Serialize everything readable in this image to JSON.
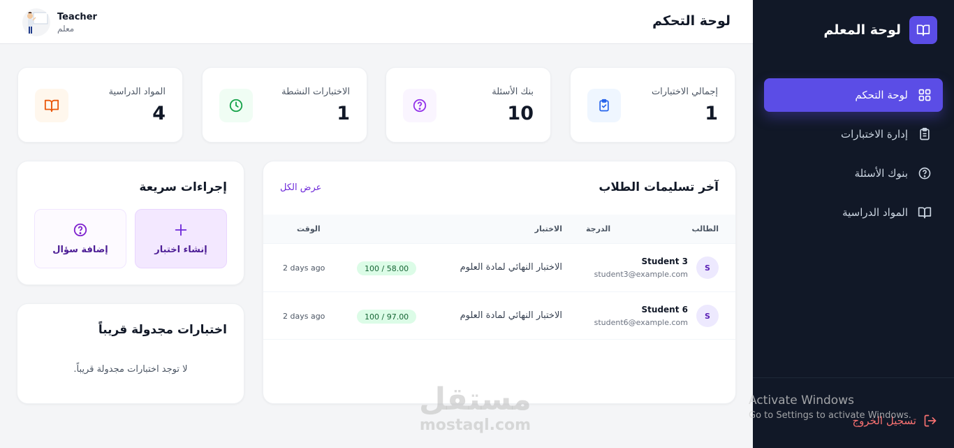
{
  "sidebar": {
    "brand": "لوحة المعلم",
    "items": [
      {
        "label": "لوحة التحكم",
        "icon": "grid-icon"
      },
      {
        "label": "إدارة الاختبارات",
        "icon": "clipboard-icon"
      },
      {
        "label": "بنوك الأسئلة",
        "icon": "question-circle-icon"
      },
      {
        "label": "المواد الدراسية",
        "icon": "book-open-icon"
      }
    ],
    "logout": "تسجيل الخروج"
  },
  "windows_watermark": {
    "line1": "Activate Windows",
    "line2": "Go to Settings to activate Windows."
  },
  "header": {
    "title": "لوحة التحكم",
    "user_name": "Teacher",
    "user_role": "معلم"
  },
  "stats": [
    {
      "label": "إجمالي الاختبارات",
      "value": "1",
      "icon": "clipboard-check-icon",
      "color": "#2563eb",
      "bg": "#eff6ff"
    },
    {
      "label": "بنك الأسئلة",
      "value": "10",
      "icon": "question-circle-icon",
      "color": "#9333ea",
      "bg": "#faf5ff"
    },
    {
      "label": "الاختبارات النشطة",
      "value": "1",
      "icon": "clock-icon",
      "color": "#16a34a",
      "bg": "#f0fdf4"
    },
    {
      "label": "المواد الدراسية",
      "value": "4",
      "icon": "book-open-icon",
      "color": "#ea580c",
      "bg": "#fff7ed"
    }
  ],
  "submissions": {
    "title": "آخر تسليمات الطلاب",
    "view_all": "عرض الكل",
    "columns": {
      "student": "الطالب",
      "exam": "الاختبار",
      "grade": "الدرجة",
      "time": "الوقت"
    },
    "rows": [
      {
        "initial": "S",
        "name": "Student 3",
        "email": "student3@example.com",
        "exam": "الاختبار النهائي لمادة العلوم",
        "grade": "100 / 58.00",
        "time": "2 days ago"
      },
      {
        "initial": "S",
        "name": "Student 6",
        "email": "student6@example.com",
        "exam": "الاختبار النهائي لمادة العلوم",
        "grade": "100 / 97.00",
        "time": "2 days ago"
      }
    ]
  },
  "quick_actions": {
    "title": "إجراءات سريعة",
    "create_exam": "إنشاء اختبار",
    "add_question": "إضافة سؤال"
  },
  "upcoming": {
    "title": "اختبارات مجدولة قريباً",
    "empty": "لا توجد اختبارات مجدولة قريباً."
  },
  "mostaql_watermark": {
    "arabic": "مستقل",
    "latin": "mostaql.com"
  }
}
